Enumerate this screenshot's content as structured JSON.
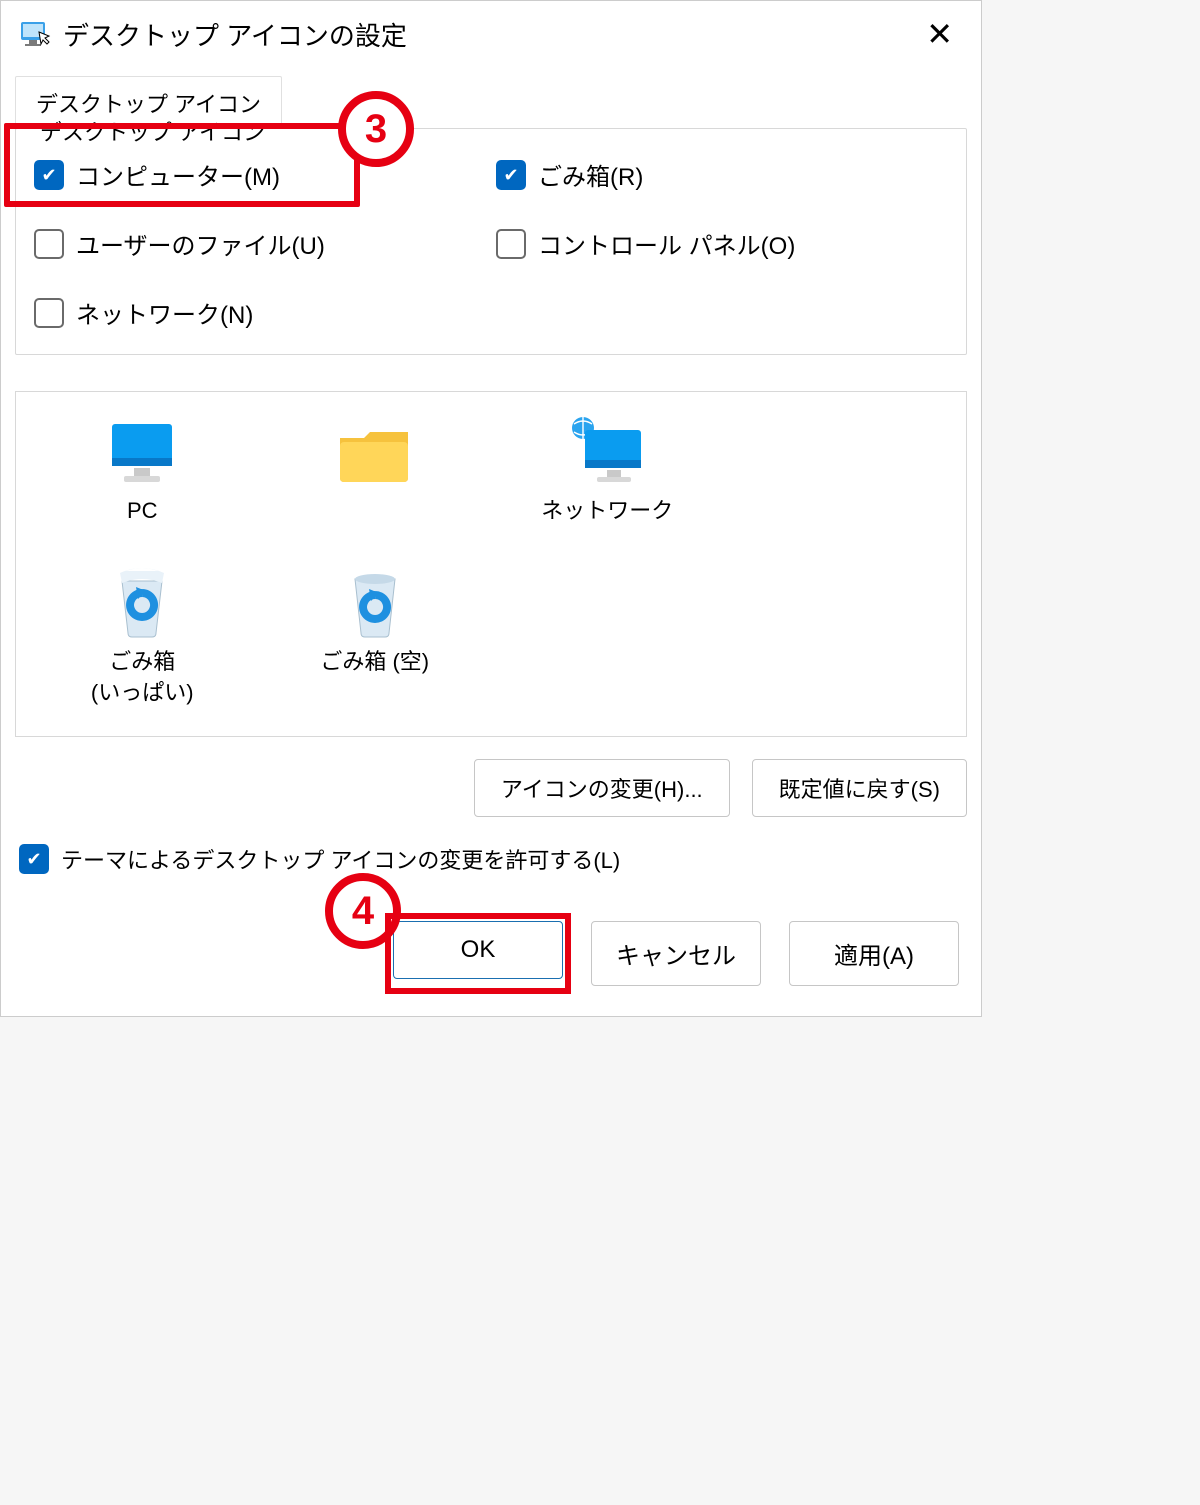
{
  "title": "デスクトップ アイコンの設定",
  "tab": "デスクトップ アイコン",
  "group_title": "デスクトップ アイコン",
  "annotations": {
    "badge3": "3",
    "badge4": "4"
  },
  "checks": {
    "computer": {
      "label": "コンピューター(M)",
      "checked": true
    },
    "recycle": {
      "label": "ごみ箱(R)",
      "checked": true
    },
    "userfiles": {
      "label": "ユーザーのファイル(U)",
      "checked": false
    },
    "control": {
      "label": "コントロール パネル(O)",
      "checked": false
    },
    "network": {
      "label": "ネットワーク(N)",
      "checked": false
    }
  },
  "preview": {
    "pc": {
      "label": "PC"
    },
    "user": {
      "label": "　　　"
    },
    "network": {
      "label": "ネットワーク"
    },
    "bin_full": {
      "label": "ごみ箱\n(いっぱい)"
    },
    "bin_empty": {
      "label": "ごみ箱 (空)"
    }
  },
  "buttons": {
    "change_icon": "アイコンの変更(H)...",
    "restore": "既定値に戻す(S)",
    "ok": "OK",
    "cancel": "キャンセル",
    "apply": "適用(A)"
  },
  "theme_allow": {
    "label": "テーマによるデスクトップ アイコンの変更を許可する(L)",
    "checked": true
  }
}
